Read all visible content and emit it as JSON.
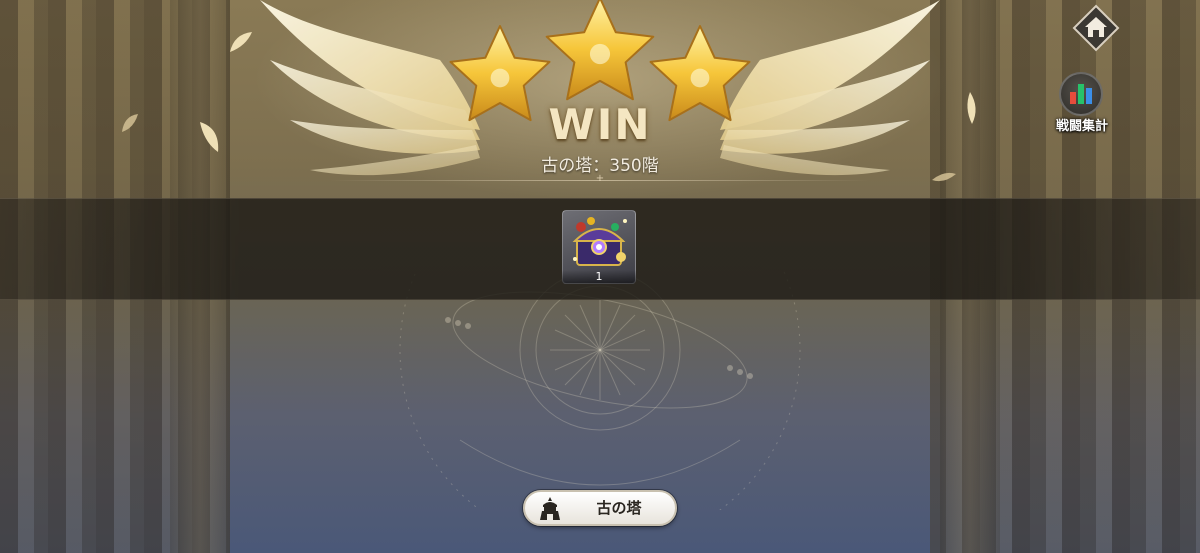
{
  "result": {
    "stars_earned": 3,
    "stars_total": 3,
    "title": "WIN",
    "stage": "古の塔：350階"
  },
  "rewards": [
    {
      "icon": "treasure-chest-icon",
      "quantity": "1"
    }
  ],
  "side_menu": {
    "home_icon": "home-icon",
    "battle_stats_label": "戦闘集計",
    "battle_stats_icon": "bar-chart-icon"
  },
  "footer": {
    "tower_button_label": "古の塔",
    "tower_button_icon": "tower-icon"
  },
  "colors": {
    "star_gold": "#f6c63a",
    "win_text": "#f4e6c2",
    "background_top": "#8a7a55",
    "background_bottom": "#4a5878"
  }
}
